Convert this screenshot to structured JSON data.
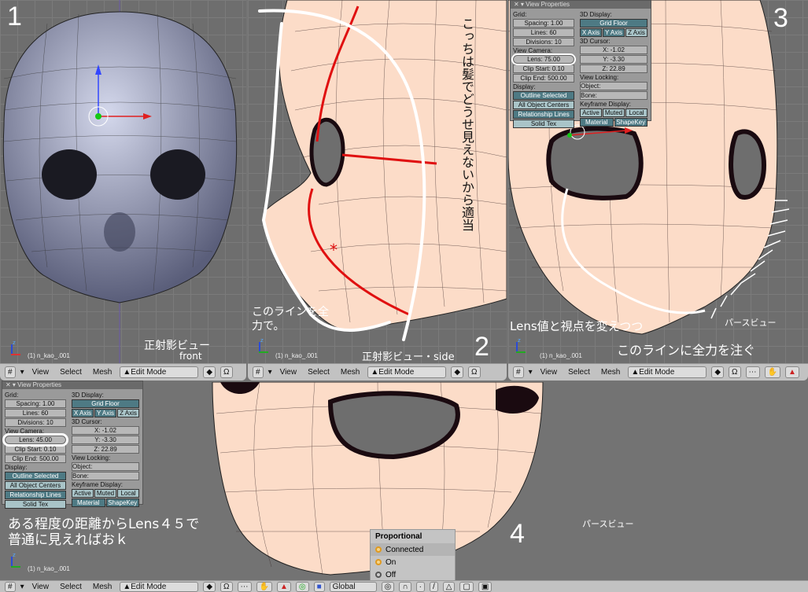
{
  "panels": [
    {
      "number": "1",
      "object_name": "(1) n_kao_.001",
      "view_label": "正射影ビュー",
      "view_sub": "front"
    },
    {
      "number": "2",
      "object_name": "(1) n_kao_.001",
      "view_label": "正射影ビュー・side",
      "annotation_vertical": "こっちは髪でどうせ見えないから適当",
      "annotation_line": "このラインを全力で。"
    },
    {
      "number": "3",
      "object_name": "(1) n_kao_.001",
      "view_label": "パースビュー",
      "annotation_lens": "Lens値と視点を変えつつ",
      "annotation_line": "このラインに全力を注ぐ"
    },
    {
      "number": "4",
      "object_name": "(1) n_kao_.001",
      "view_label": "パースビュー",
      "annotation_line1": "ある程度の距離からLens４５で",
      "annotation_line2": "普通に見えればおｋ"
    }
  ],
  "header": {
    "view": "View",
    "select": "Select",
    "mesh": "Mesh",
    "mode": "Edit Mode",
    "orientation": "Global"
  },
  "view_properties": [
    {
      "title": "View Properties",
      "grid_label": "Grid:",
      "spacing": "Spacing: 1.00",
      "lines": "Lines: 60",
      "divisions": "Divisions: 10",
      "camera_label": "View Camera:",
      "lens": "Lens: 75.00",
      "clip_start": "Clip Start: 0.10",
      "clip_end": "Clip End: 500.00",
      "display_label": "Display:",
      "outline_selected": "Outline Selected",
      "all_object_centers": "All Object Centers",
      "relationship_lines": "Relationship Lines",
      "solid_tex": "Solid Tex",
      "display3d_label": "3D Display:",
      "grid_floor": "Grid Floor",
      "x_axis": "X Axis",
      "y_axis": "Y Axis",
      "z_axis": "Z Axis",
      "cursor_label": "3D Cursor:",
      "cursor_x": "X: -1.02",
      "cursor_y": "Y: -3.30",
      "cursor_z": "Z: 22.89",
      "locking_label": "View Locking:",
      "object": "Object:",
      "bone": "Bone:",
      "keyframe_label": "Keyframe Display:",
      "active": "Active",
      "muted": "Muted",
      "local": "Local",
      "material": "Material",
      "shapekey": "ShapeKey"
    },
    {
      "title": "View Properties",
      "grid_label": "Grid:",
      "spacing": "Spacing: 1.00",
      "lines": "Lines: 60",
      "divisions": "Divisions: 10",
      "camera_label": "View Camera:",
      "lens": "Lens: 45.00",
      "clip_start": "Clip Start: 0.10",
      "clip_end": "Clip End: 500.00",
      "display_label": "Display:",
      "outline_selected": "Outline Selected",
      "all_object_centers": "All Object Centers",
      "relationship_lines": "Relationship Lines",
      "solid_tex": "Solid Tex",
      "display3d_label": "3D Display:",
      "grid_floor": "Grid Floor",
      "x_axis": "X Axis",
      "y_axis": "Y Axis",
      "z_axis": "Z Axis",
      "cursor_label": "3D Cursor:",
      "cursor_x": "X: -1.02",
      "cursor_y": "Y: -3.30",
      "cursor_z": "Z: 22.89",
      "locking_label": "View Locking:",
      "object": "Object:",
      "bone": "Bone:",
      "keyframe_label": "Keyframe Display:",
      "active": "Active",
      "muted": "Muted",
      "local": "Local",
      "material": "Material",
      "shapekey": "ShapeKey"
    }
  ],
  "proportional_menu": {
    "title": "Proportional",
    "items": [
      "Connected",
      "On",
      "Off"
    ]
  },
  "colors": {
    "viewport_bg": "#6e6e6e",
    "header_bg": "#c2c2c2",
    "skin": "#fcdcc8",
    "mesh_front": "#b8bcd6",
    "annotation_red": "#e01010",
    "annotation_white": "#ffffff"
  }
}
